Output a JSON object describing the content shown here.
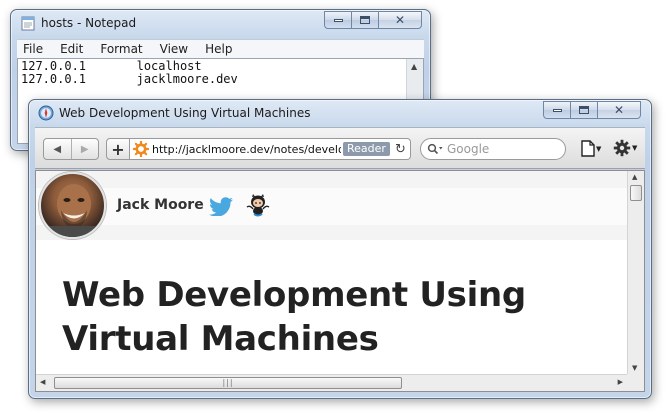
{
  "notepad": {
    "title": "hosts - Notepad",
    "menu": [
      "File",
      "Edit",
      "Format",
      "View",
      "Help"
    ],
    "content": "127.0.0.1       localhost\n127.0.0.1       jacklmoore.dev"
  },
  "browser": {
    "title": "Web Development Using Virtual Machines",
    "url": "http://jacklmoore.dev/notes/develo",
    "reader_label": "Reader",
    "search_placeholder": "Google",
    "page": {
      "author": "Jack Moore",
      "article_title": "Web Development Using Virtual Machines"
    }
  },
  "colors": {
    "title_bar": "#c9d9ec",
    "twitter_blue": "#4aa8e0",
    "heading_text": "#222222"
  },
  "icons": [
    "notepad-icon",
    "safari-icon",
    "minimize-icon",
    "maximize-icon",
    "close-icon",
    "back-icon",
    "forward-icon",
    "add-bookmark-icon",
    "favicon-icon",
    "reload-icon",
    "search-icon",
    "page-menu-icon",
    "gear-icon",
    "twitter-icon",
    "github-icon"
  ]
}
